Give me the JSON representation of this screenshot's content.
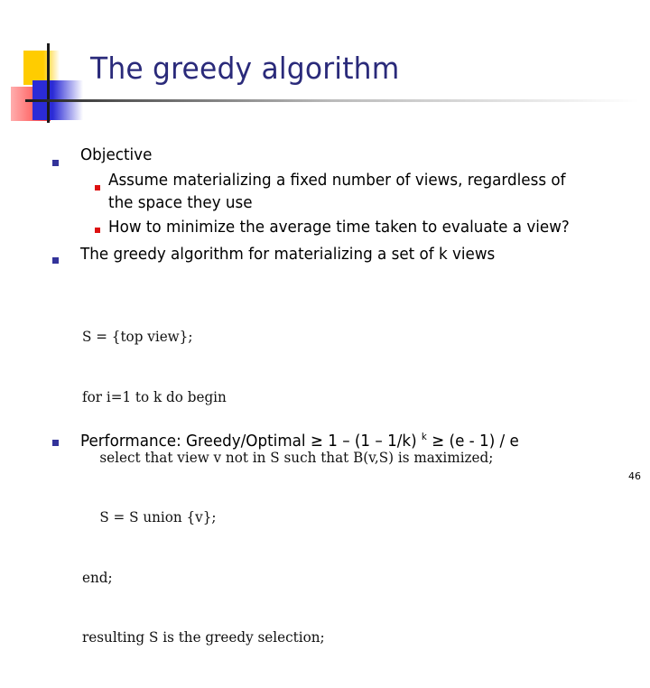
{
  "slide": {
    "title": "The greedy algorithm",
    "page_number": "46",
    "colors": {
      "title": "#2a2a7a",
      "bullet_level1": "#33339a",
      "bullet_level2": "#dd1111",
      "deco_yellow": "#ffcc00",
      "deco_blue": "#2b2bd6",
      "deco_red": "#ff3333"
    },
    "bullets": [
      {
        "text": "Objective",
        "children": [
          {
            "text": "Assume materializing a fixed number of views, regardless of",
            "text_cont": "the space they use"
          },
          {
            "text": "How to minimize the average time taken to evaluate a view?"
          }
        ]
      },
      {
        "text": "The greedy algorithm for materializing a set of k views"
      }
    ],
    "code_lines": [
      "S = {top view};",
      "for i=1 to k do begin",
      "    select that view v not in S such that B(v,S) is maximized;",
      "    S = S union {v};",
      "end;",
      "resulting S is the greedy selection;"
    ],
    "performance": {
      "prefix": "Performance: Greedy/Optimal ",
      "geq1": "≥",
      "middle": " 1 – (1 – 1/k) ",
      "exponent": "k",
      "geq2": " ≥",
      "suffix": " (e - 1) / e"
    }
  }
}
